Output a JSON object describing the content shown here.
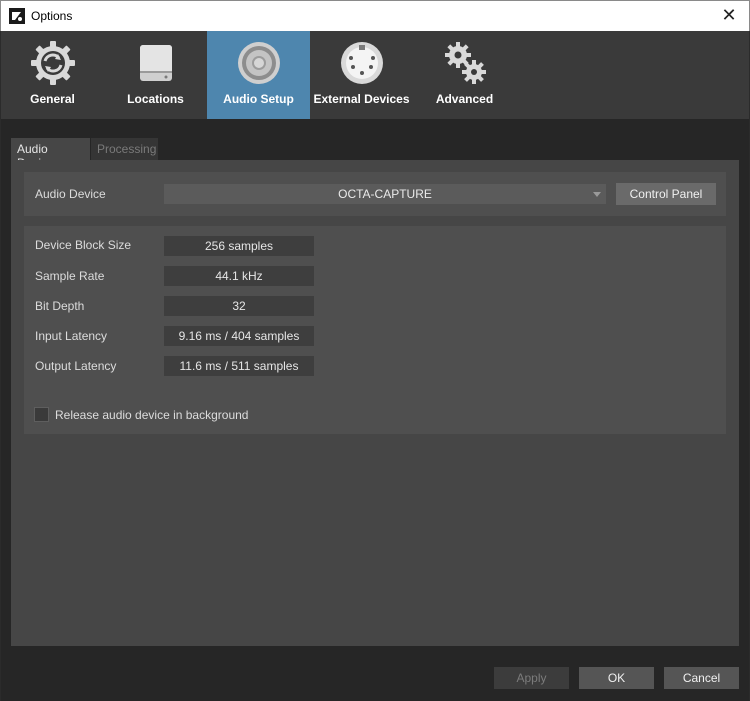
{
  "window": {
    "title": "Options",
    "close_glyph": "✕"
  },
  "categories": [
    {
      "label": "General",
      "icon": "refresh-gear-icon"
    },
    {
      "label": "Locations",
      "icon": "drive-icon"
    },
    {
      "label": "Audio Setup",
      "icon": "speaker-icon",
      "active": true
    },
    {
      "label": "External Devices",
      "icon": "midi-port-icon"
    },
    {
      "label": "Advanced",
      "icon": "gears-icon"
    }
  ],
  "tabs": [
    {
      "label": "Audio Device",
      "active": true
    },
    {
      "label": "Processing",
      "active": false
    }
  ],
  "audio_device": {
    "label": "Audio Device",
    "selected": "OCTA-CAPTURE",
    "control_panel": "Control Panel"
  },
  "info": {
    "block_size_label": "Device Block Size",
    "block_size": "256 samples",
    "sample_rate_label": "Sample Rate",
    "sample_rate": "44.1 kHz",
    "bit_depth_label": "Bit Depth",
    "bit_depth": "32",
    "input_latency_label": "Input Latency",
    "input_latency": "9.16 ms / 404 samples",
    "output_latency_label": "Output Latency",
    "output_latency": "11.6 ms / 511 samples"
  },
  "release_background": {
    "label": "Release audio device in background",
    "checked": false
  },
  "footer": {
    "apply": "Apply",
    "ok": "OK",
    "cancel": "Cancel"
  },
  "colors": {
    "accent": "#4e86ae",
    "panel": "#464646",
    "background": "#262626"
  }
}
